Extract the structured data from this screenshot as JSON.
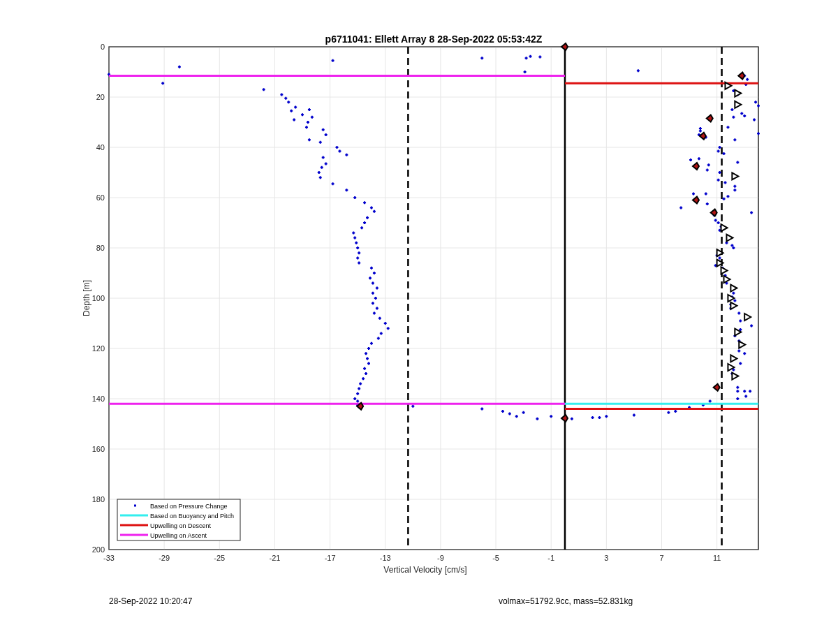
{
  "chart_data": {
    "type": "scatter",
    "title": "p6711041: Ellett Array 8 28-Sep-2022 05:53:42Z",
    "xlabel": "Vertical Velocity [cm/s]",
    "ylabel": "Depth [m]",
    "xlim": [
      -33,
      14
    ],
    "ylim": [
      200,
      0
    ],
    "grid": true,
    "legend": true,
    "xticks": [
      -33,
      -29,
      -25,
      -21,
      -17,
      -13,
      -9,
      -5,
      -1,
      3,
      7,
      11
    ],
    "yticks": [
      0,
      20,
      40,
      60,
      80,
      100,
      120,
      140,
      160,
      180,
      200
    ],
    "series": [
      {
        "name": "Based on Pressure Change",
        "color": "#0000cc",
        "type": "scatter",
        "marker": "cross",
        "x": [
          -33,
          -29.1,
          -27.9,
          -16.8,
          -21.8,
          -20.5,
          -20.2,
          -20,
          -19.5,
          -19.8,
          -18.5,
          -19,
          -18.3,
          -19.6,
          -18.6,
          -17.5,
          -18.7,
          -17.3,
          -18.5,
          -17.7,
          -16.5,
          -16.3,
          -15.8,
          -17.5,
          -17.3,
          -17.6,
          -17.8,
          -17.7,
          -16.8,
          -15.8,
          -15.2,
          -14.5,
          -14,
          -13.8,
          -14.3,
          -14.5,
          -14.7,
          -15.3,
          -15.2,
          -15.1,
          -15,
          -14.9,
          -15,
          -14.9,
          -14,
          -13.8,
          -14.1,
          -13.9,
          -13.6,
          -13.9,
          -13.7,
          -13.9,
          -13.6,
          -13.8,
          -13.4,
          -13,
          -12.8,
          -13.3,
          -13.5,
          -14,
          -14.2,
          -14.4,
          -14.3,
          -14.2,
          -14.5,
          -14.4,
          -14.6,
          -14.8,
          -14.9,
          -15,
          -15.2,
          -15,
          -6,
          -2.8,
          -2.5,
          -1.8,
          -2.9,
          5.3,
          13,
          13.2,
          13.1,
          12.2,
          12.5,
          13.8,
          14,
          12.1,
          12.8,
          13,
          12.2,
          13.7,
          11.8,
          9.8,
          9.8,
          9.7,
          10.2,
          12.3,
          14,
          11.2,
          11.1,
          11.5,
          9.1,
          9.7,
          10.4,
          10.3,
          11.2,
          12.5,
          11.1,
          11.6,
          12.3,
          12.3,
          9.3,
          10.2,
          8.4,
          10.3,
          11.8,
          11.5,
          13.5,
          10.8,
          10.9,
          11.1,
          11.3,
          11.2,
          11.7,
          12.1,
          12.2,
          11,
          11.2,
          10.9,
          11.4,
          11.6,
          11.7,
          12.2,
          12.1,
          12.3,
          12,
          12,
          12.6,
          12.7,
          13.5,
          12.7,
          12.3,
          12.6,
          12.6,
          13,
          12.7,
          12.2,
          12.1,
          12.5,
          12.5,
          13.4,
          13.1,
          -11,
          -15,
          -6,
          -4.5,
          -4,
          -3.5,
          -3,
          -2,
          -1,
          0.5,
          2,
          2.5,
          3,
          5,
          7.5,
          8,
          9,
          10,
          10.5,
          13,
          12.5
        ],
        "values": [
          11,
          14.5,
          8,
          5.5,
          17,
          19,
          20.5,
          22,
          24,
          25.5,
          25,
          27,
          28,
          29,
          30,
          33,
          32,
          35,
          37,
          38,
          40,
          41.5,
          43,
          44,
          46.5,
          48,
          50,
          52,
          54.5,
          57,
          60,
          62,
          64,
          65.5,
          68,
          70,
          72,
          74,
          76,
          78,
          80,
          82,
          84,
          86,
          88,
          90,
          92,
          94,
          96,
          98,
          100,
          102,
          104,
          106,
          108,
          110,
          112,
          114,
          116,
          118,
          120,
          122,
          124,
          126,
          128,
          130,
          132,
          134,
          136,
          138,
          140,
          141,
          4.5,
          4.5,
          3.8,
          4,
          10,
          9.5,
          11.5,
          13,
          15,
          17.5,
          19,
          22,
          23.5,
          25,
          26.5,
          27.5,
          28,
          29,
          32,
          32.5,
          33.5,
          35,
          36,
          37,
          34.5,
          40,
          41.5,
          42.5,
          45,
          44.5,
          47,
          49,
          50,
          46,
          53,
          54,
          55.5,
          57,
          58.5,
          58.5,
          64,
          62.5,
          59.5,
          60.5,
          66,
          67,
          69,
          70,
          71.5,
          73,
          78,
          79,
          80,
          83,
          84,
          87,
          88,
          91,
          94,
          98,
          99.5,
          101,
          102.5,
          104,
          106,
          109,
          111,
          112.5,
          115,
          117,
          121,
          122,
          126,
          128.5,
          130,
          135.5,
          137,
          137,
          139,
          143,
          142.5,
          144,
          145,
          146,
          147,
          145.5,
          148,
          147,
          148,
          147.5,
          147.5,
          147,
          146.5,
          145.5,
          145,
          143.5,
          142.5,
          141,
          137,
          140
        ]
      },
      {
        "name": "Based on Buoyancy and Pitch",
        "color": "#33eeee",
        "type": "line",
        "x": [
          -0.1,
          14
        ],
        "values": [
          142,
          142
        ]
      },
      {
        "name": "Upwelling on Descent",
        "color": "#dd1111",
        "type": "line",
        "x": [
          0,
          14
        ],
        "values": [
          14.5,
          14.5
        ]
      },
      {
        "name": "Upwelling on Ascent",
        "color": "#ee22ee",
        "type": "line",
        "x": [
          -33,
          0
        ],
        "values": [
          11.5,
          11.5
        ]
      },
      {
        "color": "#dd1111",
        "type": "line",
        "x": [
          0,
          14
        ],
        "values": [
          144,
          144
        ]
      },
      {
        "color": "#ee22ee",
        "type": "line",
        "x": [
          -33,
          0
        ],
        "values": [
          142,
          142
        ]
      },
      {
        "color": "#000000",
        "type": "scatter",
        "marker": "triangle",
        "x": [
          11.8,
          12.5,
          12.5,
          12.3,
          11.5,
          11.9,
          11.2,
          11.2,
          11.5,
          11.7,
          12.2,
          12,
          12.2,
          13.2,
          12.5,
          12.8,
          12.2,
          12,
          12.3
        ],
        "values": [
          15.5,
          18.5,
          23,
          51.5,
          72,
          76,
          82,
          86,
          89,
          92.5,
          96,
          100,
          103,
          107.5,
          113.5,
          118.5,
          124,
          127.5,
          131
        ]
      },
      {
        "color": "#b01515",
        "type": "scatter",
        "marker": "diamond",
        "x": [
          0,
          12.8,
          10.5,
          10,
          9.5,
          9.5,
          10.8,
          11,
          -14.8,
          0
        ],
        "values": [
          0,
          11.5,
          28.5,
          35.5,
          47.5,
          61,
          66,
          135.5,
          143,
          147.8
        ]
      }
    ],
    "ref_lines": [
      {
        "axis": "x",
        "value": -11.35
      },
      {
        "axis": "x",
        "value": 11.35
      },
      {
        "axis": "x",
        "value": 0
      }
    ]
  },
  "footer": {
    "timestamp": "28-Sep-2022 10:20:47",
    "info": "volmax=51792.9cc, mass=52.831kg"
  }
}
